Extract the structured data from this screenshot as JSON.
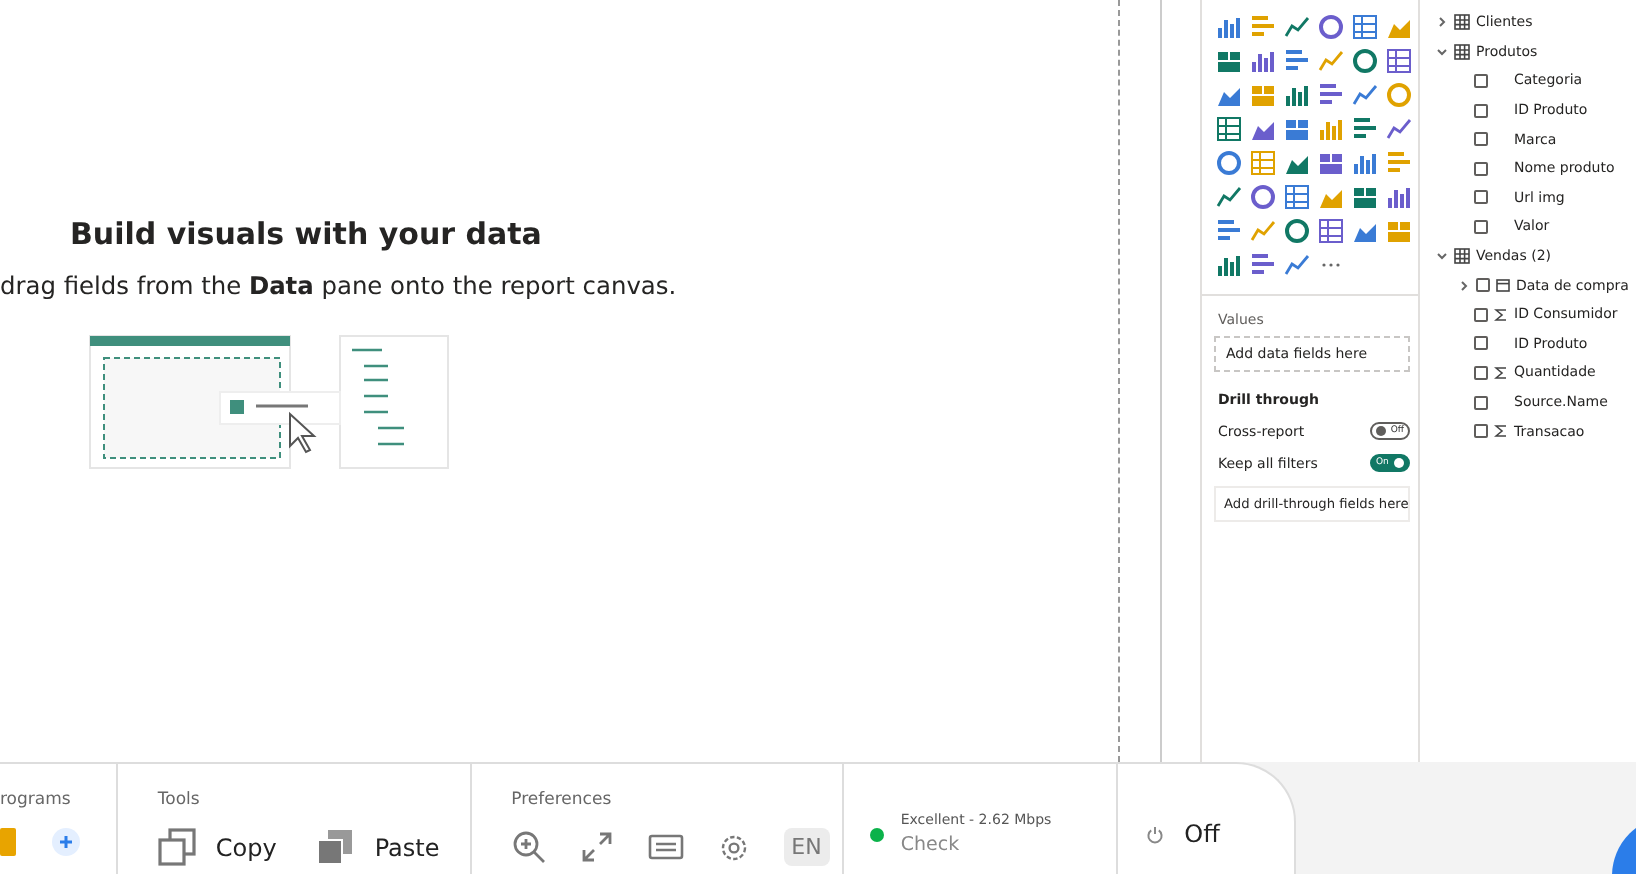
{
  "canvas": {
    "heading": "Build visuals with your data",
    "hint": "drag fields from the **Data** pane onto the report canvas."
  },
  "visualizations": {
    "values_label": "Values",
    "values_placeholder": "Add data fields here",
    "drill_title": "Drill through",
    "toggles": [
      {
        "label": "Cross-report",
        "on": false,
        "state_text": "Off"
      },
      {
        "label": "Keep all filters",
        "on": true,
        "state_text": "On"
      }
    ],
    "drill_placeholder": "Add drill-through fields here"
  },
  "data_pane": {
    "tables": [
      {
        "name": "Clientes",
        "expanded": false
      },
      {
        "name": "Produtos",
        "expanded": true,
        "children": [
          {
            "name": "Categoria",
            "kind": "plain",
            "checked": false
          },
          {
            "name": "ID Produto",
            "kind": "plain",
            "checked": false
          },
          {
            "name": "Marca",
            "kind": "plain",
            "checked": false
          },
          {
            "name": "Nome produto",
            "kind": "plain",
            "checked": false
          },
          {
            "name": "Url img",
            "kind": "plain",
            "checked": false
          },
          {
            "name": "Valor",
            "kind": "plain",
            "checked": false
          }
        ]
      },
      {
        "name": "Vendas (2)",
        "expanded": true,
        "children": [
          {
            "name": "Data de compra",
            "kind": "date",
            "checked": false
          },
          {
            "name": "ID Consumidor",
            "kind": "sum",
            "checked": false
          },
          {
            "name": "ID Produto",
            "kind": "plain",
            "checked": false
          },
          {
            "name": "Quantidade",
            "kind": "sum",
            "checked": false
          },
          {
            "name": "Source.Name",
            "kind": "plain",
            "checked": false
          },
          {
            "name": "Transacao",
            "kind": "sum",
            "checked": false
          }
        ]
      }
    ]
  },
  "bottom_bar": {
    "programs_label": "rograms",
    "tools_label": "Tools",
    "tools": [
      {
        "label": "Copy",
        "kind": "copy"
      },
      {
        "label": "Paste",
        "kind": "paste"
      }
    ],
    "preferences_label": "Preferences",
    "language": "EN",
    "connection": {
      "quality": "Excellent - 2.62 Mbps",
      "action": "Check",
      "color": "#0bb24a"
    },
    "power": "Off"
  }
}
